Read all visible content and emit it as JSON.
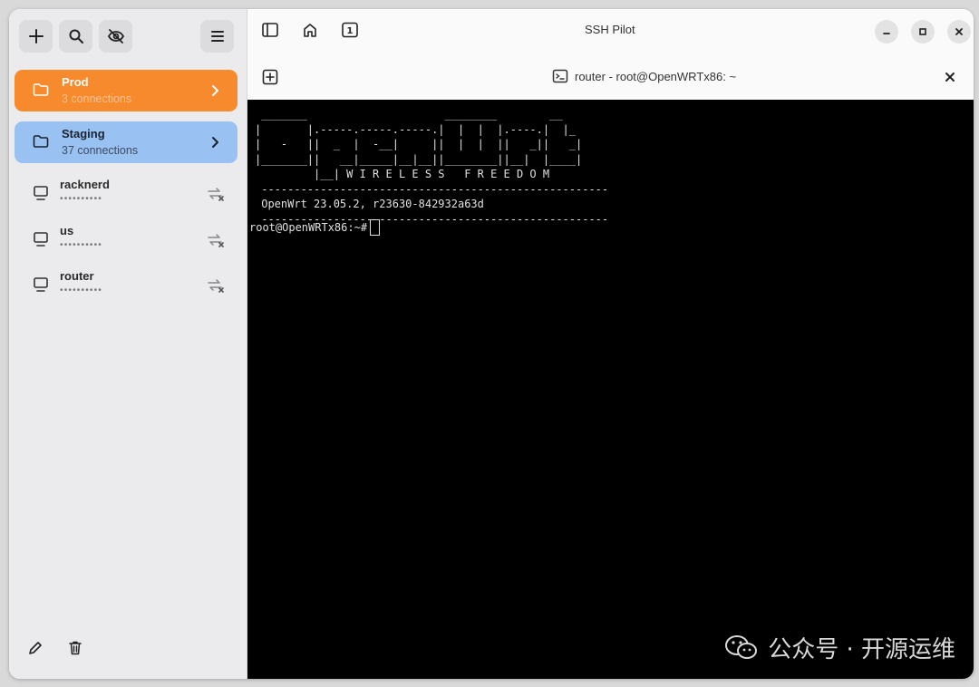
{
  "app": {
    "title": "SSH Pilot"
  },
  "sidebar": {
    "groups": [
      {
        "name": "Prod",
        "count": "3 connections",
        "color": "#f68a2d"
      },
      {
        "name": "Staging",
        "count": "37 connections",
        "color": "#99c1f1"
      }
    ],
    "hosts": [
      {
        "name": "racknerd",
        "detail": "••••••••••"
      },
      {
        "name": "us",
        "detail": "••••••••••"
      },
      {
        "name": "router",
        "detail": "••••••••••"
      }
    ],
    "toolbar_icons": [
      "add-icon",
      "search-icon",
      "hide-icon",
      "menu-icon"
    ],
    "footer_icons": [
      "edit-icon",
      "delete-icon"
    ]
  },
  "tab": {
    "title": "router - root@OpenWRTx86: ~"
  },
  "terminal": {
    "lines": [
      " _______                     ________        __",
      "|       |.-----.-----.-----.|  |  |  |.----.|  |_",
      "|   -   ||  _  |  -__|     ||  |  |  ||   _||   _|",
      "|_______||   __|_____|__|__||________||__|  |____|",
      "         |__| W I R E L E S S   F R E E D O M",
      " -----------------------------------------------------",
      " OpenWrt 23.05.2, r23630-842932a63d",
      " -----------------------------------------------------"
    ],
    "prompt": "root@OpenWRTx86:~#"
  },
  "watermark": {
    "text": "公众号 · 开源运维"
  }
}
